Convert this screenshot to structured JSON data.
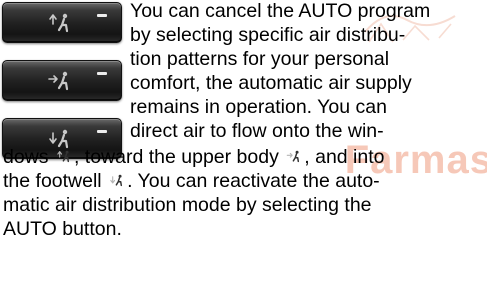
{
  "buttons": [
    {
      "name": "windshield",
      "icon": "air-windshield-icon"
    },
    {
      "name": "upper-body",
      "icon": "air-upper-body-icon"
    },
    {
      "name": "footwell",
      "icon": "air-footwell-icon"
    }
  ],
  "text": {
    "l1": "You can cancel the AUTO program",
    "l2": "by selecting specific air distribu-",
    "l3": "tion patterns for your personal",
    "l4": "comfort, the automatic air supply",
    "l5": "remains in operation. You can",
    "l6": "direct air to flow onto the win-",
    "l7a": "dows",
    "l7b": ", toward the upper body",
    "l7c": ", and into",
    "l8a": "the footwell",
    "l8b": ". You can reactivate the auto-",
    "l9": "matic air distribution mode by selecting the",
    "l10": "AUTO button."
  },
  "watermark": {
    "text": "Farmas"
  },
  "colors": {
    "button_led": "#ececec",
    "watermark": "#f6c8b8",
    "icon": "#bdbdbd"
  }
}
